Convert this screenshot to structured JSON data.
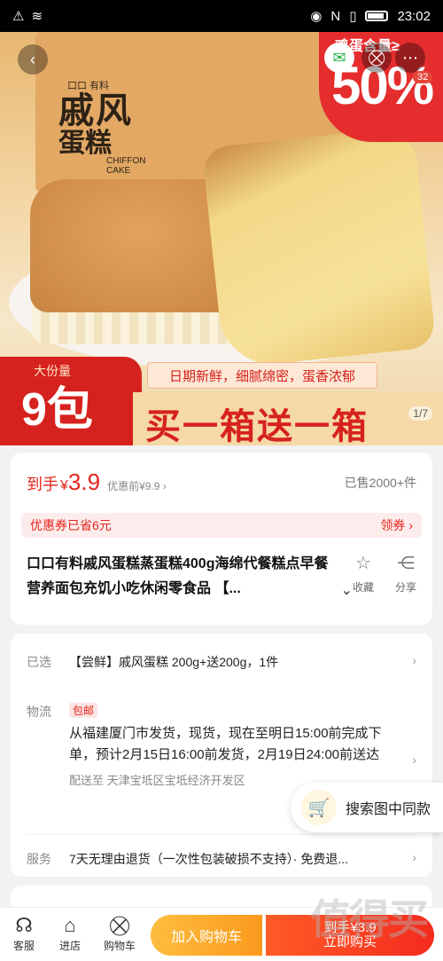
{
  "status_bar": {
    "time": "23:02"
  },
  "hero": {
    "brand": "口口 有料",
    "product_title": "戚风",
    "product_subtitle": "蛋糕",
    "product_en": "CHIFFON CAKE",
    "badge_top": "鸡蛋含量≥",
    "badge_pct": "50%",
    "cart_count": "32"
  },
  "promo": {
    "caption": "大份量",
    "count": "9包",
    "slogan": "日期新鲜，细腻绵密，蛋香浓郁",
    "banner": "买一箱送一箱",
    "pager": "1/7"
  },
  "price": {
    "label": "到手",
    "symbol": "¥",
    "value": "3.9",
    "original": "优惠前¥9.9 ›",
    "sold": "已售2000+件"
  },
  "coupon": {
    "text": "优惠券已省6元",
    "action": "领券 ›"
  },
  "product": {
    "title": "口口有料戚风蛋糕蒸蛋糕400g海绵代餐糕点早餐营养面包充饥小吃休闲零食品 【...",
    "favorite": "收藏",
    "share": "分享"
  },
  "details": {
    "selected_key": "已选",
    "selected_val": "【尝鲜】戚风蛋糕 200g+送200g，1件",
    "logistics_key": "物流",
    "logistics_tag": "包邮",
    "logistics_val": "从福建厦门市发货，现货，现在至明日15:00前完成下单，预计2月15日16:00前发货，2月19日24:00前送达",
    "delivery_to": "配送至 天津宝坻区宝坻经济开发区",
    "service_key": "服务",
    "service_val": "7天无理由退货（一次性包装破损不支持）· 免费退..."
  },
  "float_search": "搜索图中同款",
  "bottom": {
    "service": "客服",
    "shop": "进店",
    "cart": "购物车",
    "add_cart": "加入购物车",
    "buy_price": "到手¥3.9",
    "buy_label": "立即购买"
  },
  "watermark": "值得买"
}
